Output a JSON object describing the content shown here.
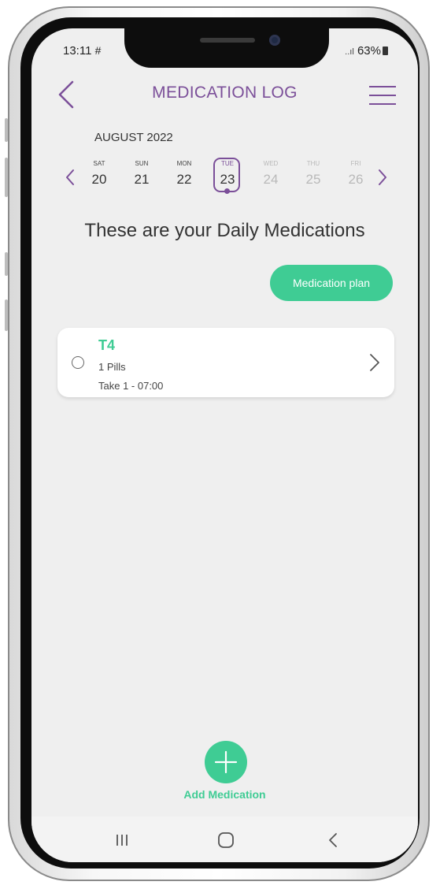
{
  "status_bar": {
    "time": "13:11",
    "time_icon": "hash-icon",
    "signal_text": "..ıl",
    "battery": "63%"
  },
  "header": {
    "title": "MEDICATION LOG",
    "back_icon": "chevron-left-icon",
    "menu_icon": "hamburger-menu-icon"
  },
  "calendar": {
    "month": "AUGUST 2022",
    "days": [
      {
        "name": "SAT",
        "num": "20",
        "state": "past"
      },
      {
        "name": "SUN",
        "num": "21",
        "state": "past"
      },
      {
        "name": "MON",
        "num": "22",
        "state": "past"
      },
      {
        "name": "TUE",
        "num": "23",
        "state": "selected"
      },
      {
        "name": "WED",
        "num": "24",
        "state": "future"
      },
      {
        "name": "THU",
        "num": "25",
        "state": "future"
      },
      {
        "name": "FRI",
        "num": "26",
        "state": "future"
      }
    ]
  },
  "main": {
    "section_title": "These are your Daily Medications",
    "plan_button": "Medication plan"
  },
  "medications": [
    {
      "name": "T4",
      "dose": "1 Pills",
      "schedule": "Take 1 - 07:00"
    }
  ],
  "fab": {
    "label": "Add Medication"
  },
  "colors": {
    "accent_purple": "#7b4f99",
    "accent_green": "#3fcc94",
    "background": "#efefef"
  }
}
